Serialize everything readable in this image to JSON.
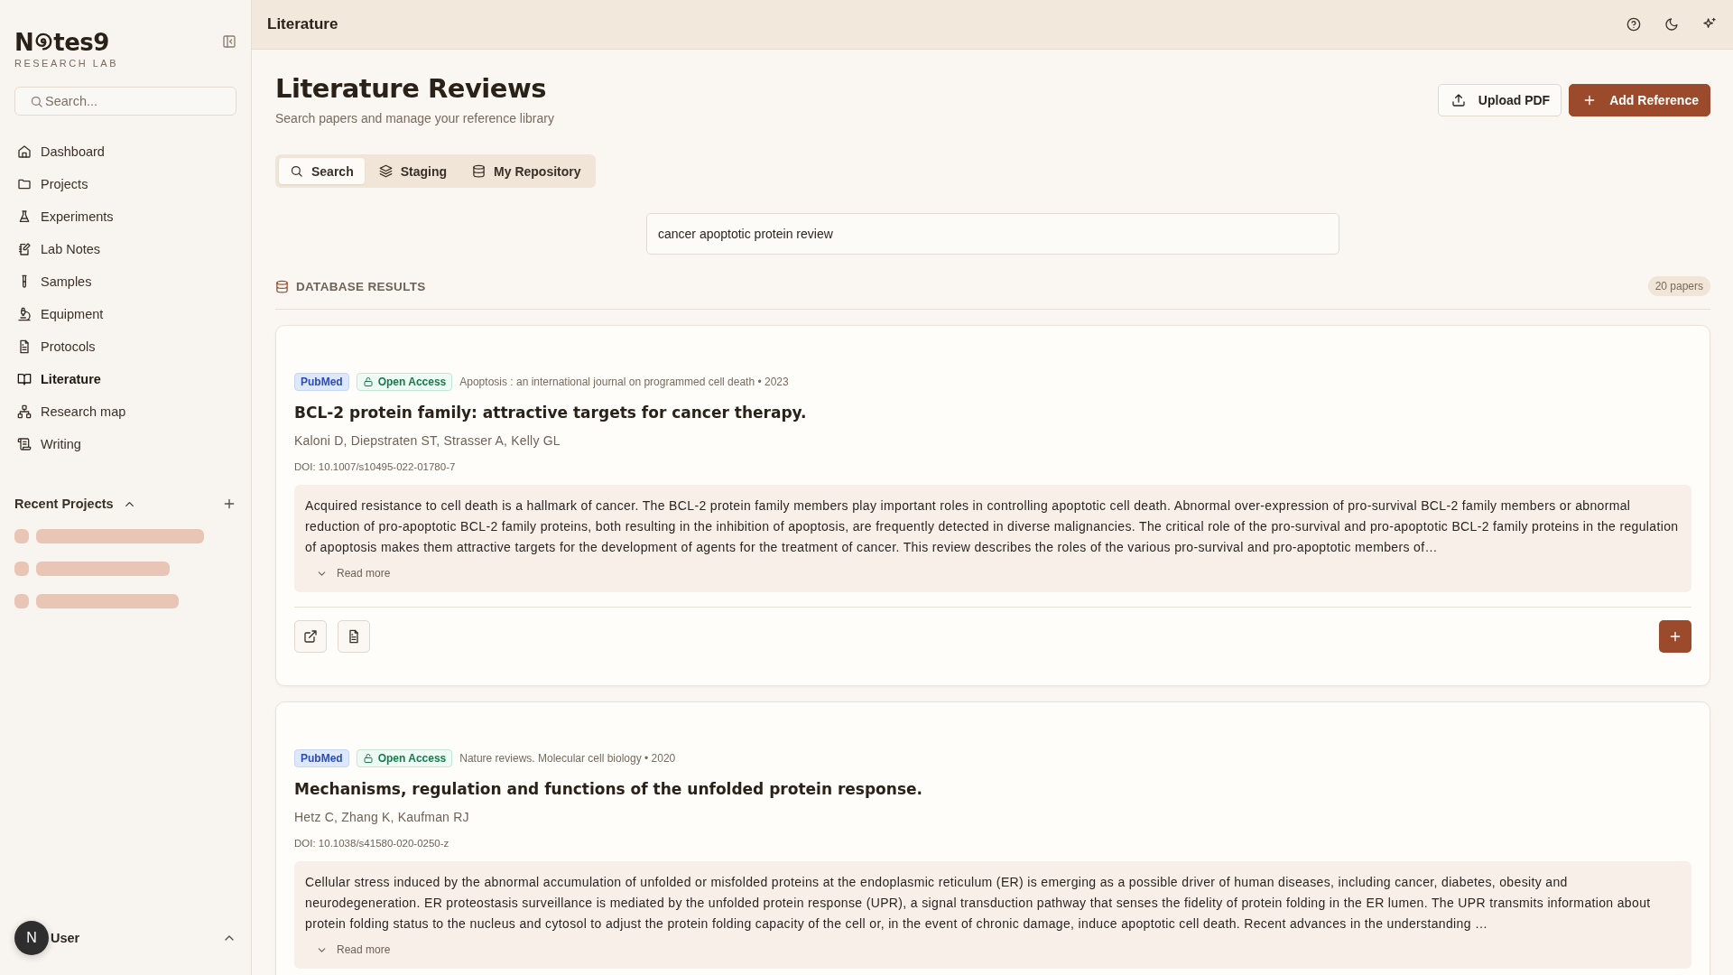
{
  "sidebar": {
    "logo": {
      "before": "N",
      "after": "tes9",
      "subtitle": "RESEARCH LAB"
    },
    "search": {
      "placeholder": "Search..."
    },
    "items": [
      {
        "label": "Dashboard",
        "kind": "home",
        "selected": false
      },
      {
        "label": "Projects",
        "kind": "folder",
        "selected": false
      },
      {
        "label": "Experiments",
        "kind": "flask",
        "selected": false
      },
      {
        "label": "Lab Notes",
        "kind": "notebook",
        "selected": false
      },
      {
        "label": "Samples",
        "kind": "tube",
        "selected": false
      },
      {
        "label": "Equipment",
        "kind": "microscope",
        "selected": false
      },
      {
        "label": "Protocols",
        "kind": "document",
        "selected": false
      },
      {
        "label": "Literature",
        "kind": "book",
        "selected": true
      },
      {
        "label": "Research map",
        "kind": "network",
        "selected": false
      },
      {
        "label": "Writing",
        "kind": "scroll",
        "selected": false
      }
    ],
    "recent_projects": {
      "title": "Recent Projects",
      "expanded": true,
      "loading": true
    },
    "user": {
      "initial": "N",
      "name": "User"
    }
  },
  "header": {
    "title": "Literature"
  },
  "page": {
    "title": "Literature Reviews",
    "subtitle": "Search papers and manage your reference library",
    "actions": [
      {
        "label": "Upload PDF",
        "kind": "upload"
      },
      {
        "label": "Add Reference",
        "kind": "add"
      }
    ]
  },
  "tabs": [
    {
      "label": "Search",
      "kind": "search",
      "selected": true
    },
    {
      "label": "Staging",
      "kind": "layers",
      "selected": false
    },
    {
      "label": "My Repository",
      "kind": "database",
      "selected": false
    }
  ],
  "query": {
    "value": "cancer apoptotic protein review"
  },
  "results": {
    "title": "DATABASE RESULTS",
    "count": "20 papers",
    "papers": [
      {
        "source": "PubMed",
        "access": "Open Access",
        "journal": "Apoptosis : an international journal on programmed cell death • 2023",
        "title": "BCL-2 protein family: attractive targets for cancer therapy.",
        "authors": "Kaloni D, Diepstraten ST, Strasser A, Kelly GL",
        "doi": "DOI: 10.1007/s10495-022-01780-7",
        "abstract": "Acquired resistance to cell death is a hallmark of cancer. The BCL-2 protein family members play important roles in controlling apoptotic cell death. Abnormal over-expression of pro-survival BCL-2 family members or abnormal reduction of pro-apoptotic BCL-2 family proteins, both resulting in the inhibition of apoptosis, are frequently detected in diverse malignancies. The critical role of the pro-survival and pro-apoptotic BCL-2 family proteins in the regulation of apoptosis makes them attractive targets for the development of agents for the treatment of cancer. This review describes the roles of the various pro-survival and pro-apoptotic members of…",
        "more": "Read more"
      },
      {
        "source": "PubMed",
        "access": "Open Access",
        "journal": "Nature reviews. Molecular cell biology • 2020",
        "title": "Mechanisms, regulation and functions of the unfolded protein response.",
        "authors": "Hetz C, Zhang K, Kaufman RJ",
        "doi": "DOI: 10.1038/s41580-020-0250-z",
        "abstract": "Cellular stress induced by the abnormal accumulation of unfolded or misfolded proteins at the endoplasmic reticulum (ER) is emerging as a possible driver of human diseases, including cancer, diabetes, obesity and neurodegeneration. ER proteostasis surveillance is mediated by the unfolded protein response (UPR), a signal transduction pathway that senses the fidelity of protein folding in the ER lumen. The UPR transmits information about protein folding status to the nucleus and cytosol to adjust the protein folding capacity of the cell or, in the event of chronic damage, induce apoptotic cell death. Recent advances in the understanding …",
        "more": "Read more"
      }
    ]
  }
}
